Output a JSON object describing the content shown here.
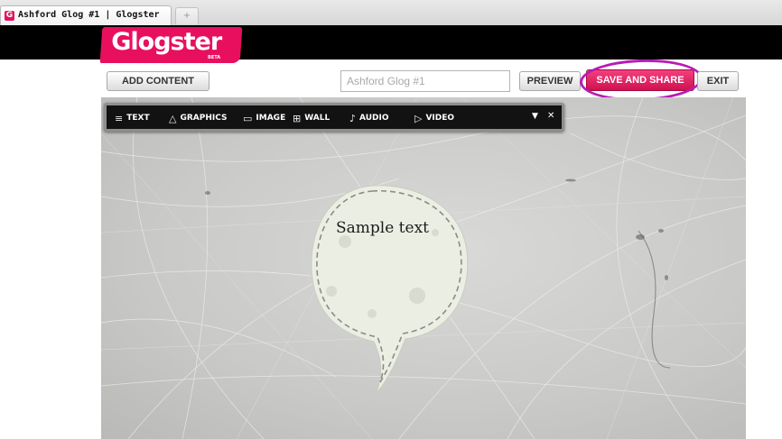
{
  "browser": {
    "tab_title": "Ashford Glog #1 | Glogster",
    "favicon_letter": "G",
    "newtab_glyph": "+"
  },
  "app": {
    "logo_text": "Glogster",
    "logo_badge": "BETA",
    "brand_color": "#e8105e"
  },
  "toolbar": {
    "add_content_label": "ADD CONTENT",
    "title_field_placeholder": "Ashford Glog #1",
    "preview_label": "PREVIEW",
    "save_share_label": "SAVE AND SHARE",
    "exit_label": "EXIT",
    "highlight_color": "#b81cb4"
  },
  "edit_toolbar": {
    "items": [
      {
        "label": "TEXT",
        "icon": "≡",
        "icon_name": "text-lines-icon"
      },
      {
        "label": "GRAPHICS",
        "icon": "△",
        "icon_name": "triangle-icon"
      },
      {
        "label": "IMAGE",
        "icon": "▭",
        "icon_name": "image-icon"
      },
      {
        "label": "WALL",
        "icon": "⊞",
        "icon_name": "wall-icon"
      },
      {
        "label": "AUDIO",
        "icon": "♪",
        "icon_name": "music-note-icon"
      },
      {
        "label": "VIDEO",
        "icon": "▷",
        "icon_name": "play-circle-icon"
      }
    ],
    "collapse_glyph": "▼",
    "close_glyph": "✕"
  },
  "canvas": {
    "sample_text": "Sample text"
  }
}
